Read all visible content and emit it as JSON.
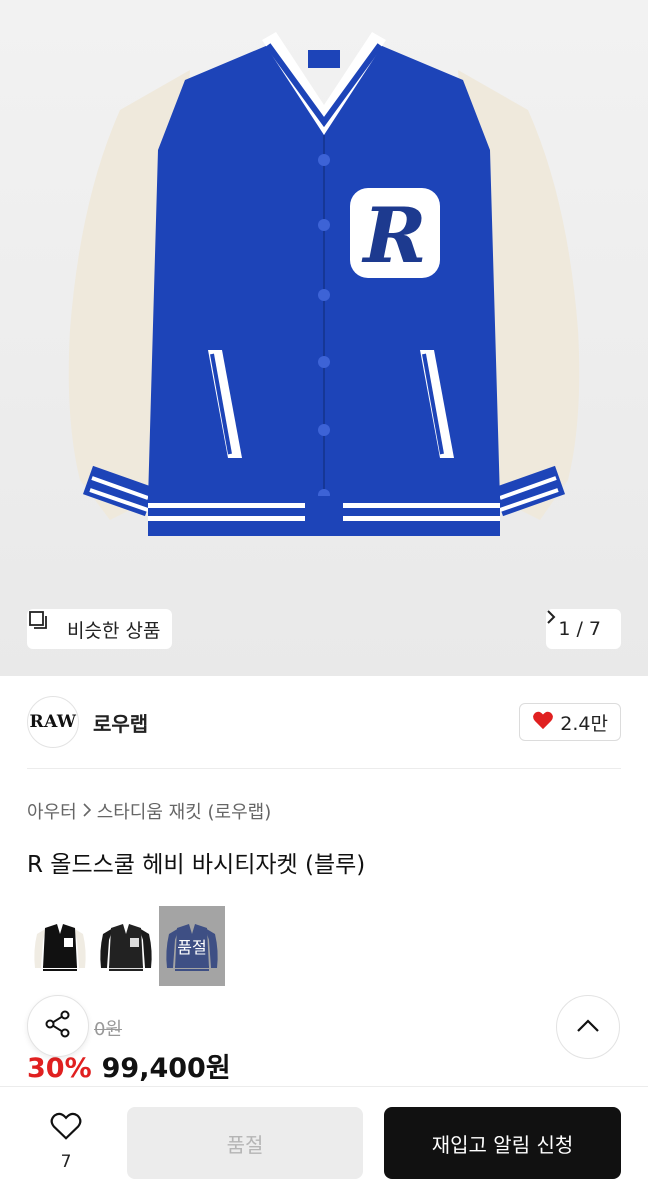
{
  "hero": {
    "similar_label": "비슷한 상품",
    "pager": "1 / 7",
    "icons": {
      "similar": "similar-items-icon",
      "next": "chevron-right-icon"
    }
  },
  "brand": {
    "logo_text": "RAW",
    "name": "로우랩",
    "like_count": "2.4만",
    "like_color": "#e02020"
  },
  "breadcrumb": {
    "category": "아우터",
    "subcategory": "스타디움 재킷 (로우랩)"
  },
  "product": {
    "title": "R 올드스쿨 헤비 바시티자켓 (블루)",
    "variants": [
      {
        "label": "black-white",
        "soldout": false
      },
      {
        "label": "black",
        "soldout": false
      },
      {
        "label": "blue",
        "soldout": true,
        "soldout_text": "품절"
      }
    ],
    "original_price": "0원",
    "discount": "30%",
    "price": "99,400원"
  },
  "bottom": {
    "wish_count": "7",
    "soldout_label": "품절",
    "restock_label": "재입고 알림 신청"
  },
  "colors": {
    "jacket_blue": "#1d44b8",
    "sleeve_cream": "#efe9dc",
    "discount_red": "#e02020"
  }
}
